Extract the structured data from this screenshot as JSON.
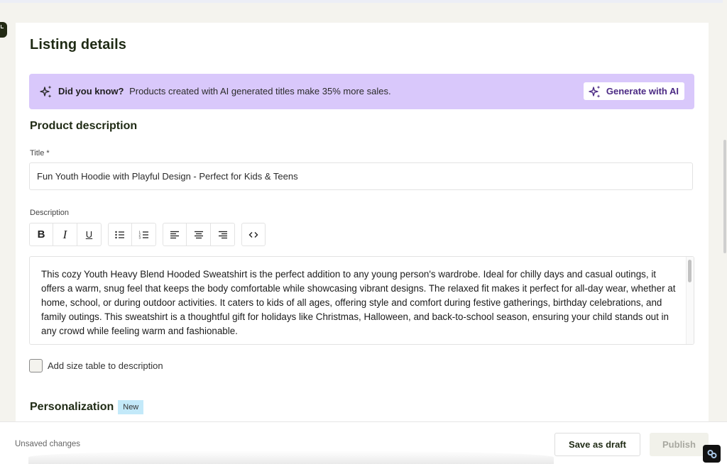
{
  "page": {
    "title": "Listing details"
  },
  "ai_banner": {
    "icon": "sparkles-icon",
    "tip_bold": "Did you know?",
    "tip_text": "Products created with AI generated titles make 35% more sales.",
    "button_label": "Generate with AI",
    "background_color": "#d9c8fb",
    "button_text_color": "#4b2a84"
  },
  "product_description": {
    "section_title": "Product description",
    "title_label": "Title *",
    "title_value": "Fun Youth Hoodie with Playful Design - Perfect for Kids & Teens",
    "description_label": "Description",
    "toolbar": {
      "groups": [
        [
          {
            "name": "bold",
            "icon": "bold-icon",
            "glyph": "B"
          },
          {
            "name": "italic",
            "icon": "italic-icon",
            "glyph": "I"
          },
          {
            "name": "underline",
            "icon": "underline-icon",
            "glyph": "U"
          }
        ],
        [
          {
            "name": "bullet-list",
            "icon": "bullet-list-icon"
          },
          {
            "name": "numbered-list",
            "icon": "numbered-list-icon"
          }
        ],
        [
          {
            "name": "align-left",
            "icon": "align-left-icon"
          },
          {
            "name": "align-center",
            "icon": "align-center-icon"
          },
          {
            "name": "align-right",
            "icon": "align-right-icon"
          }
        ],
        [
          {
            "name": "code",
            "icon": "code-icon",
            "glyph": "<>"
          }
        ]
      ]
    },
    "description_value": "This cozy Youth Heavy Blend Hooded Sweatshirt is the perfect addition to any young person's wardrobe. Ideal for chilly days and casual outings, it offers a warm, snug feel that keeps the body comfortable while showcasing vibrant designs. The relaxed fit makes it perfect for all-day wear, whether at home, school, or during outdoor activities. It caters to kids of all ages, offering style and comfort during festive gatherings, birthday celebrations, and family outings. This sweatshirt is a thoughtful gift for holidays like Christmas, Halloween, and back-to-school season, ensuring your child stands out in any crowd while feeling warm and fashionable.",
    "size_table_checkbox": {
      "label": "Add size table to description",
      "checked": false
    }
  },
  "personalization": {
    "section_title": "Personalization",
    "badge": "New",
    "badge_color": "#c3e9f9"
  },
  "footer": {
    "status": "Unsaved changes",
    "save_draft_label": "Save as draft",
    "publish_label": "Publish",
    "publish_disabled": true
  },
  "widget": {
    "icon": "link-icon"
  }
}
